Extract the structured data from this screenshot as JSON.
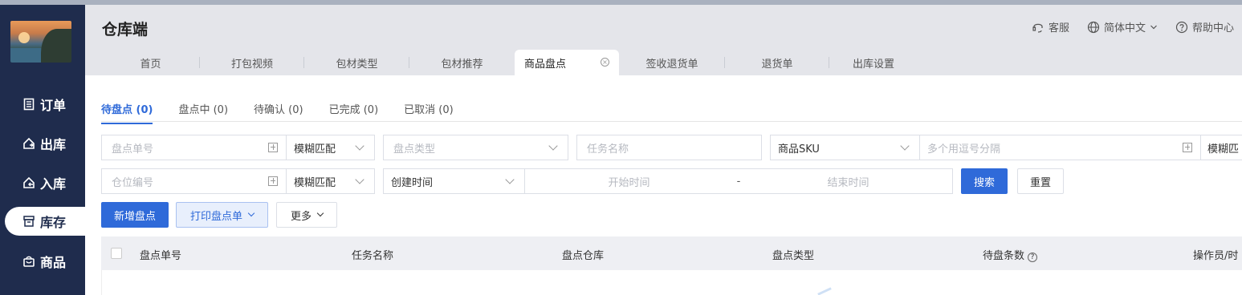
{
  "app": {
    "title": "仓库端"
  },
  "header_links": [
    {
      "label": "客服",
      "icon": "headset-icon"
    },
    {
      "label": "简体中文",
      "icon": "globe-icon"
    },
    {
      "label": "帮助中心",
      "icon": "help-circle-icon"
    }
  ],
  "sidebar": {
    "items": [
      {
        "label": "订单",
        "icon": "order-list-icon"
      },
      {
        "label": "出库",
        "icon": "outbound-icon"
      },
      {
        "label": "入库",
        "icon": "inbound-icon"
      },
      {
        "label": "库存",
        "icon": "inventory-icon",
        "active": true
      },
      {
        "label": "商品",
        "icon": "goods-bag-icon"
      }
    ]
  },
  "tabs": [
    {
      "label": "首页"
    },
    {
      "label": "打包视频"
    },
    {
      "label": "包材类型"
    },
    {
      "label": "包材推荐"
    },
    {
      "label": "商品盘点",
      "active": true
    },
    {
      "label": "签收退货单"
    },
    {
      "label": "退货单"
    },
    {
      "label": "出库设置"
    }
  ],
  "status_tabs": [
    {
      "label": "待盘点 (0)",
      "active": true
    },
    {
      "label": "盘点中 (0)"
    },
    {
      "label": "待确认 (0)"
    },
    {
      "label": "已完成 (0)"
    },
    {
      "label": "已取消 (0)"
    }
  ],
  "filters": {
    "count_no_placeholder": "盘点单号",
    "match_mode_1": "模糊匹配",
    "count_type_placeholder": "盘点类型",
    "task_name_placeholder": "任务名称",
    "sku_select": "商品SKU",
    "sku_input_placeholder": "多个用逗号分隔",
    "match_mode_3": "模糊匹",
    "location_placeholder": "仓位编号",
    "match_mode_2": "模糊匹配",
    "time_type": "创建时间",
    "start_placeholder": "开始时间",
    "range_sep": "-",
    "end_placeholder": "结束时间",
    "search_label": "搜索",
    "reset_label": "重置"
  },
  "actions": {
    "new_label": "新增盘点",
    "print_label": "打印盘点单",
    "more_label": "更多"
  },
  "table": {
    "columns": [
      "盘点单号",
      "任务名称",
      "盘点仓库",
      "盘点类型",
      "待盘条数",
      "操作员/时"
    ]
  },
  "colors": {
    "primary": "#2f6ad9",
    "sidebar": "#1f2c4d",
    "header": "#e4e5ea"
  }
}
